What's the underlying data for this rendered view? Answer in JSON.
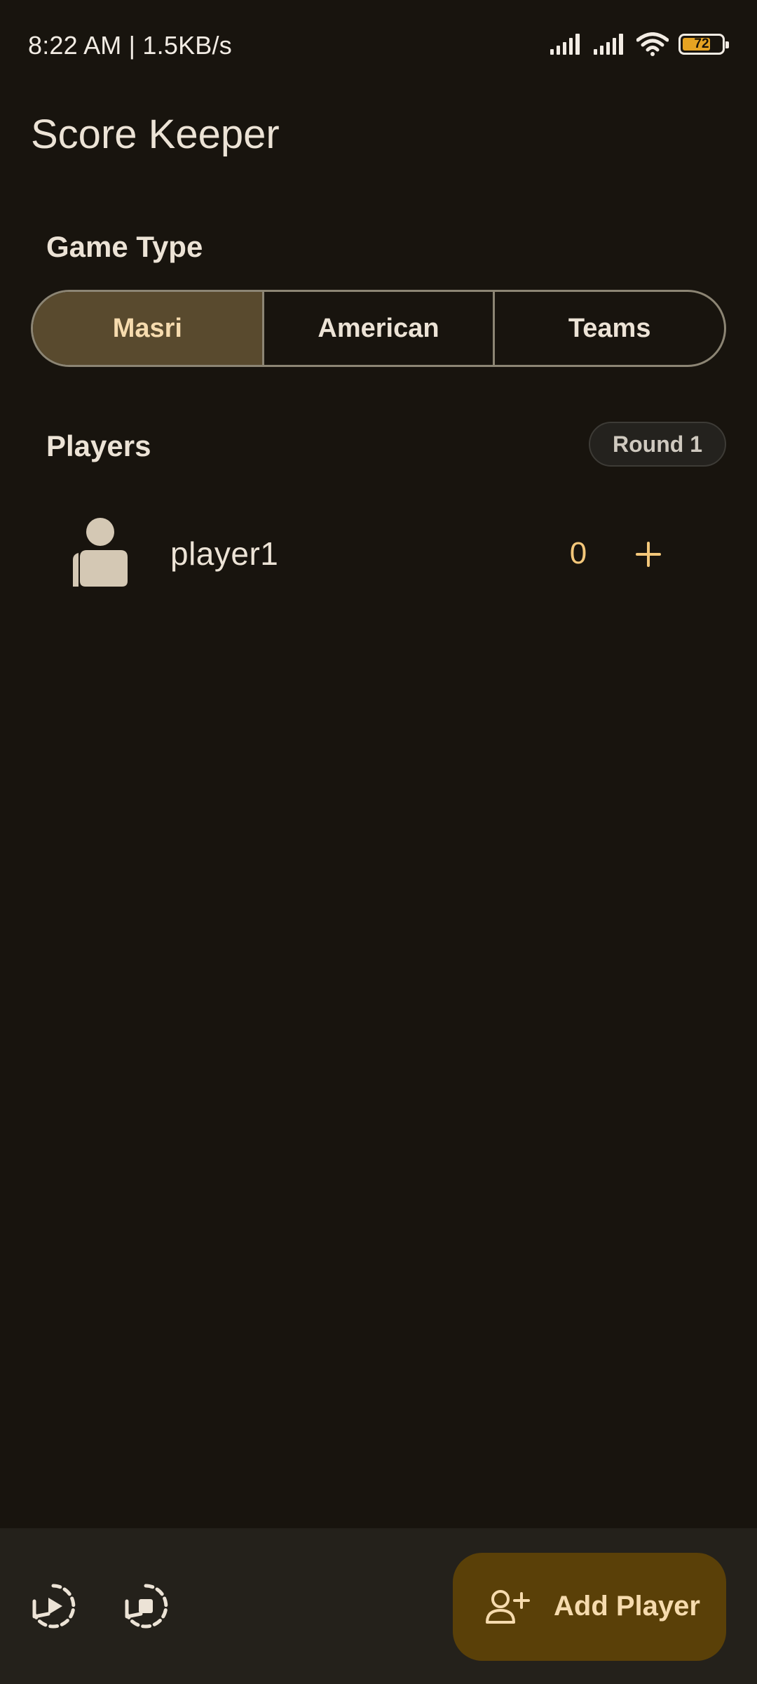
{
  "status_bar": {
    "time_speed": "8:22 AM | 1.5KB/s",
    "battery_level": "72",
    "battery_fraction": 0.72,
    "icons": [
      "signal-icon",
      "signal-icon",
      "wifi-icon",
      "battery-icon"
    ]
  },
  "app": {
    "title": "Score Keeper"
  },
  "game_type": {
    "label": "Game Type",
    "options": [
      "Masri",
      "American",
      "Teams"
    ],
    "selected": "Masri"
  },
  "players_section": {
    "label": "Players",
    "round_badge": "Round 1",
    "players": [
      {
        "name": "player1",
        "score": "0",
        "avatar_icon": "person-icon",
        "action_icon": "plus-icon"
      }
    ]
  },
  "bottom_bar": {
    "icons": [
      "replay-icon",
      "stop-restart-icon"
    ],
    "add_player_label": "Add Player",
    "add_player_icon": "person-add-icon"
  },
  "colors": {
    "background": "#18140e",
    "accent": "#f3c77a",
    "selected_segment": "#594a2e",
    "add_player_button": "#5a4008",
    "bottom_bar": "#24211b"
  }
}
